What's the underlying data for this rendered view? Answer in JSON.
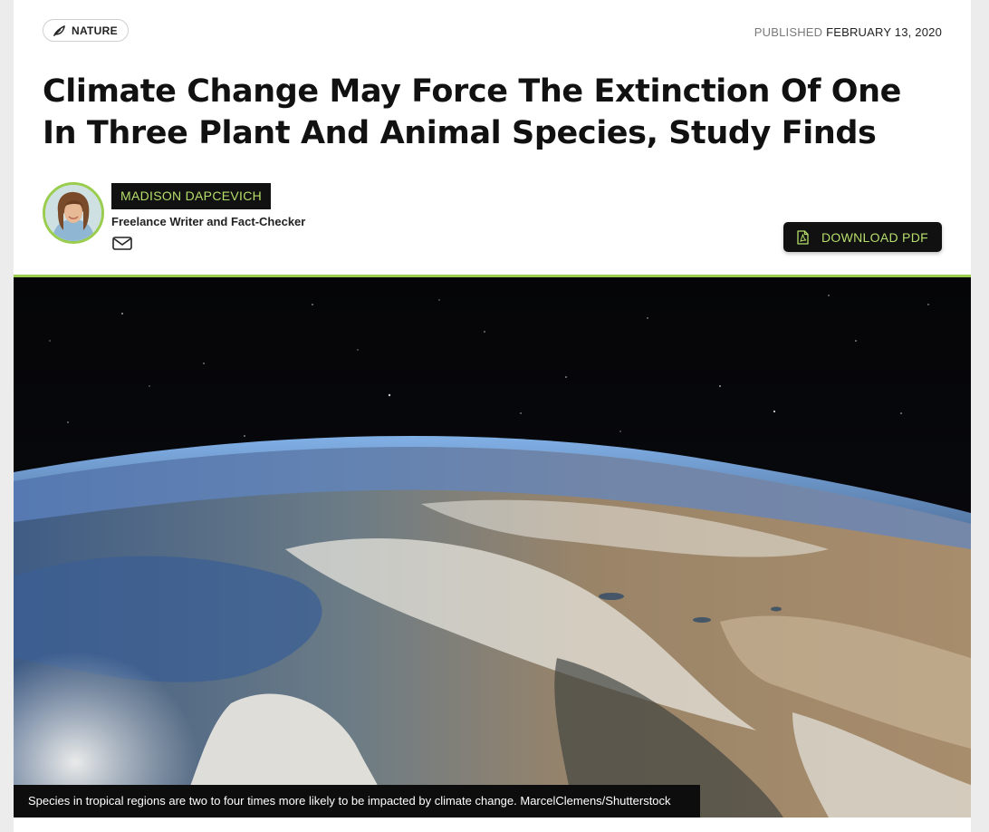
{
  "category": {
    "label": "NATURE",
    "icon": "leaf-icon"
  },
  "published": {
    "label": "PUBLISHED",
    "date": "FEBRUARY 13, 2020"
  },
  "article": {
    "title": "Climate Change May Force The Extinction Of One In Three Plant And Animal Species, Study Finds"
  },
  "author": {
    "name": "MADISON DAPCEVICH",
    "role": "Freelance Writer and Fact-Checker",
    "contact_icon": "envelope-icon"
  },
  "download": {
    "label": "DOWNLOAD PDF",
    "icon": "pdf-file-icon"
  },
  "hero_image": {
    "caption": "Species in tropical regions are two to four times more likely to be impacted by climate change. MarcelClemens/Shutterstock"
  },
  "colors": {
    "accent": "#9acd4e",
    "accent_text": "#b6de6a",
    "dark": "#111111"
  }
}
